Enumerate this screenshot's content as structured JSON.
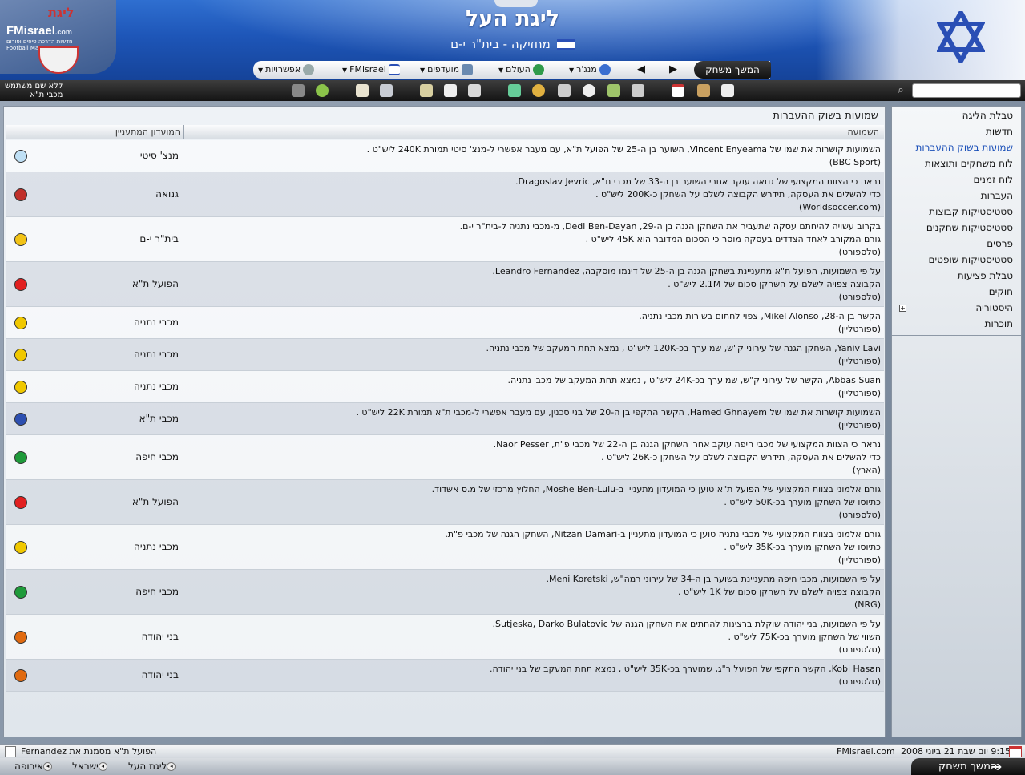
{
  "header": {
    "title": "ליגת העל",
    "subtitle": "מחזיקה - בית\"ר י-ם",
    "logo_text": "FMisrael",
    "logo_domain": ".com",
    "logo_tagline": "חדשות הדרכה טיפים ופורום Football Manager לגיימר",
    "logo_badge": "ליגת"
  },
  "nav": {
    "continue_label": "המשך משחק",
    "manager": "מנג'ר",
    "world": "העולם",
    "favorites": "מועדפים",
    "fmisrael": "FMisrael",
    "options": "אפשרויות"
  },
  "toolbar": {
    "user_line1": "ללא שם משתמש",
    "user_line2": "מכבי ת\"א"
  },
  "panel": {
    "title": "שמועות בשוק ההעברות",
    "col_rumour": "השמועה",
    "col_club": "המועדון המתעניין"
  },
  "rumours": [
    {
      "lines": [
        "השמועות קושרות את שמו של Vincent Enyeama, השוער בן ה-25 של הפועל ת\"א, עם מעבר אפשרי ל-מנצ' סיטי תמורת 240K ליש\"ט .",
        "(BBC Sport)"
      ],
      "club": "מנצ' סיטי",
      "color": "#bfe0f5"
    },
    {
      "lines": [
        "נראה כי הצוות המקצועי של גנואה עוקב אחרי השוער בן ה-33 של מכבי ת\"א, Dragoslav Jevric.",
        "כדי להשלים את העסקה, תידרש הקבוצה לשלם על השחקן כ-200K ליש\"ט .",
        "(Worldsoccer.com)"
      ],
      "club": "גנואה",
      "color": "#c0302a"
    },
    {
      "lines": [
        "בקרוב עשויה להיחתם עסקה שתעביר את השחקן הגנה בן ה-29, Dedi Ben-Dayan, מ-מכבי נתניה ל-בית\"ר י-ם.",
        "גורם המקורב לאחד הצדדים בעסקה מוסר כי הסכום המדובר הוא 45K ליש\"ט .",
        "(טלספורט)"
      ],
      "club": "בית\"ר י-ם",
      "color": "#f2c316"
    },
    {
      "lines": [
        "על פי השמועות, הפועל ת\"א מתעניינת בשחקן הגנה בן ה-25 של דינמו מוסקבה, Leandro Fernandez.",
        "הקבוצה צפויה לשלם על השחקן סכום של 2.1M ליש\"ט .",
        "(טלספורט)"
      ],
      "club": "הפועל ת\"א",
      "color": "#e12020"
    },
    {
      "lines": [
        "הקשר בן ה-28, Mikel Alonso, צפוי לחתום בשורות מכבי נתניה.",
        "(ספורטליין)"
      ],
      "club": "מכבי נתניה",
      "color": "#f0c800"
    },
    {
      "lines": [
        "Yaniv Lavi, השחקן הגנה של עירוני ק\"ש, שמוערך בכ-120K ליש\"ט , נמצא תחת המעקב של מכבי נתניה.",
        "(ספורטליין)"
      ],
      "club": "מכבי נתניה",
      "color": "#f0c800"
    },
    {
      "lines": [
        "Abbas Suan, הקשר של עירוני ק\"ש, שמוערך בכ-24K ליש\"ט , נמצא תחת המעקב של מכבי נתניה.",
        "(ספורטליין)"
      ],
      "club": "מכבי נתניה",
      "color": "#f0c800"
    },
    {
      "lines": [
        "השמועות קושרות את שמו של Hamed Ghnayem, הקשר התקפי בן ה-20 של בני סכנין, עם מעבר אפשרי ל-מכבי ת\"א תמורת 22K ליש\"ט .",
        "(ספורטליין)"
      ],
      "club": "מכבי ת\"א",
      "color": "#2d4fb0"
    },
    {
      "lines": [
        "נראה כי הצוות המקצועי של מכבי חיפה עוקב אחרי השחקן הגנה בן ה-22 של מכבי פ\"ת, Naor Pesser.",
        "כדי להשלים את העסקה, תידרש הקבוצה לשלם על השחקן כ-26K ליש\"ט .",
        "(הארץ)"
      ],
      "club": "מכבי חיפה",
      "color": "#1f9a3a"
    },
    {
      "lines": [
        "גורם אלמוני בצוות המקצועי של הפועל ת\"א טוען כי המועדון מתעניין ב-Moshe Ben-Lulu, החלוץ מרכזי של מ.ס אשדוד.",
        "כתיוסו של השחקן מוערך בכ-50K ליש\"ט .",
        "(טלספורט)"
      ],
      "club": "הפועל ת\"א",
      "color": "#e12020"
    },
    {
      "lines": [
        "גורם אלמוני בצוות המקצועי של מכבי נתניה טוען כי המועדון מתעניין ב-Nitzan Damari, השחקן הגנה של מכבי פ\"ת.",
        "כתיוסו של השחקן מוערך בכ-35K ליש\"ט .",
        "(ספורטליין)"
      ],
      "club": "מכבי נתניה",
      "color": "#f0c800"
    },
    {
      "lines": [
        "על פי השמועות, מכבי חיפה מתעניינת בשוער בן ה-34 של עירוני רמה\"ש, Meni Koretski.",
        "הקבוצה צפויה לשלם על השחקן סכום של 1K ליש\"ט .",
        "(NRG)"
      ],
      "club": "מכבי חיפה",
      "color": "#1f9a3a"
    },
    {
      "lines": [
        "על פי השמועות, בני יהודה שוקלת ברצינות להחתים את השחקן הגנה של Sutjeska, Darko Bulatovic.",
        "השווי של השחקן מוערך בכ-75K ליש\"ט .",
        "(טלספורט)"
      ],
      "club": "בני יהודה",
      "color": "#e06a10"
    },
    {
      "lines": [
        "Kobi Hasan, הקשר התקפי של הפועל ר\"ג, שמוערך בכ-35K ליש\"ט , נמצא תחת המעקב של בני יהודה.",
        "(טלספורט)"
      ],
      "club": "בני יהודה",
      "color": "#e06a10"
    }
  ],
  "menu": [
    {
      "label": "טבלת הליגה",
      "active": false
    },
    {
      "label": "חדשות",
      "active": false
    },
    {
      "label": "שמועות בשוק ההעברות",
      "active": true
    },
    {
      "label": "לוח משחקים ותוצאות",
      "active": false
    },
    {
      "label": "לוח זמנים",
      "active": false
    },
    {
      "label": "העברות",
      "active": false
    },
    {
      "label": "סטטיסטיקות קבוצות",
      "active": false
    },
    {
      "label": "סטטיסטיקות שחקנים",
      "active": false
    },
    {
      "label": "פרסים",
      "active": false
    },
    {
      "label": "סטטיסטיקות שופטים",
      "active": false
    },
    {
      "label": "טבלת פציעות",
      "active": false
    },
    {
      "label": "חוקים",
      "active": false
    },
    {
      "label": "היסטוריה",
      "active": false
    },
    {
      "label": "תוכרות",
      "active": false
    }
  ],
  "status": {
    "news": "הפועל ת\"א מסמנת את Fernandez",
    "site": "FMisrael.com",
    "datetime": "9:15 יום שבת 21 ביוני 2008"
  },
  "bottom": {
    "crumb1": "ליגת העל",
    "crumb2": "ישראל",
    "crumb3": "אירופה",
    "continue_label": "המשך משחק"
  },
  "colors": {
    "header_blue": "#1e56b8",
    "link_blue": "#1b50b8"
  }
}
